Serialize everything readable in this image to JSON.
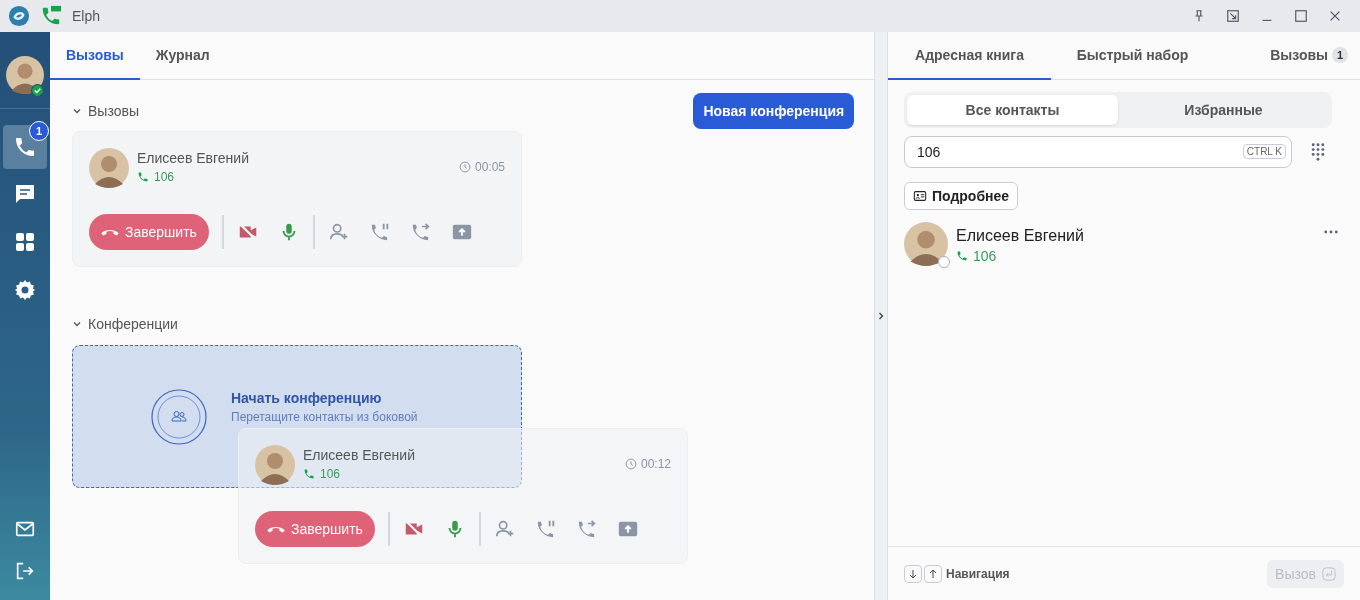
{
  "window": {
    "title": "Elph"
  },
  "user": {
    "online": true
  },
  "sidebar": {
    "items": [
      {
        "kind": "phone",
        "selected": true,
        "badge": "1"
      },
      {
        "kind": "chat",
        "selected": false
      },
      {
        "kind": "apps",
        "selected": false
      },
      {
        "kind": "settings",
        "selected": false
      }
    ],
    "bottom_items": [
      {
        "kind": "mail"
      },
      {
        "kind": "logout"
      }
    ]
  },
  "main_tabs": [
    {
      "label": "Вызовы",
      "selected": true
    },
    {
      "label": "Журнал",
      "selected": false
    }
  ],
  "calls_section": {
    "title": "Вызовы",
    "expanded": true,
    "new_conference_button": "Новая конференция"
  },
  "calls": [
    {
      "name": "Елисеев Евгений",
      "number": "106",
      "duration": "00:05",
      "end_button": "Завершить",
      "camera_on": false,
      "mic_on": true
    }
  ],
  "conference_section": {
    "title": "Конференции",
    "expanded": true,
    "drop_title": "Начать конференцию",
    "drop_hint": "Перетащите контакты из боковой"
  },
  "dragged_call": {
    "name": "Елисеев Евгений",
    "number": "106",
    "duration": "00:12",
    "end_button": "Завершить",
    "camera_on": false,
    "mic_on": true
  },
  "right_tabs": [
    {
      "label": "Адресная книга",
      "selected": true
    },
    {
      "label": "Быстрый набор",
      "selected": false
    },
    {
      "label": "Вызовы",
      "selected": false,
      "badge": "1"
    }
  ],
  "filter": [
    {
      "label": "Все контакты",
      "selected": true
    },
    {
      "label": "Избранные",
      "selected": false
    }
  ],
  "search": {
    "value": "106",
    "shortcut": "CTRL K"
  },
  "details_button": "Подробнее",
  "contacts": [
    {
      "name": "Елисеев Евгений",
      "number": "106",
      "online": false
    }
  ],
  "footer": {
    "hint": "Навигация",
    "call_button": {
      "label": "Вызов",
      "disabled": true
    }
  }
}
